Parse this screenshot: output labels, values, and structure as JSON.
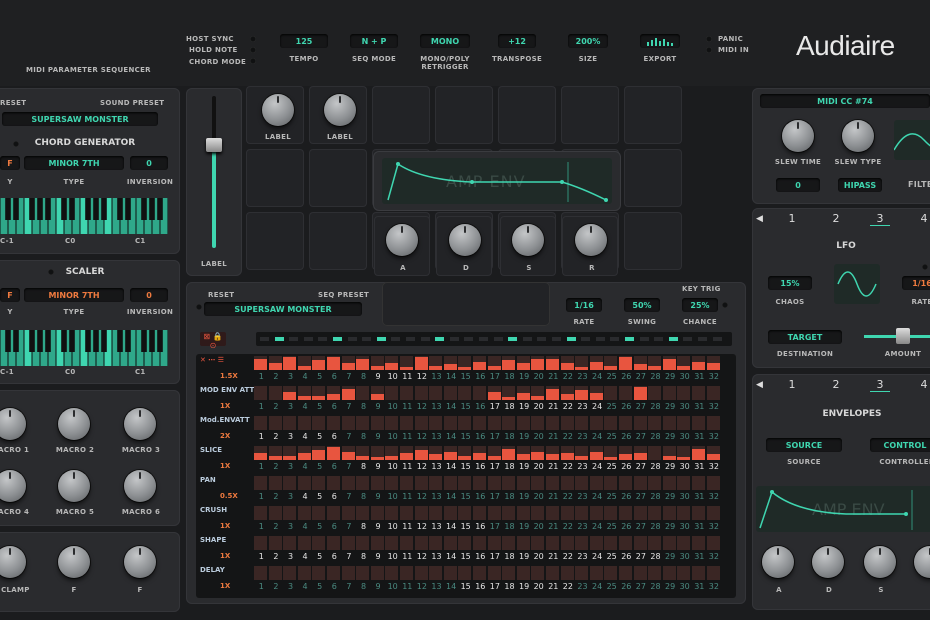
{
  "header": {
    "host_sync": "HOST SYNC",
    "hold_note": "HOLD NOTE",
    "chord_mode": "CHORD MODE",
    "subtitle": "MIDI PARAMETER SEQUENCER",
    "panic": "PANIC",
    "midi_in": "MIDI IN",
    "logo": "Audiaire",
    "params": [
      {
        "value": "125",
        "label": "TEMPO"
      },
      {
        "value": "N + P",
        "label": "SEQ MODE"
      },
      {
        "value": "MONO",
        "label": "MONO/POLY RETRIGGER"
      },
      {
        "value": "+12",
        "label": "TRANSPOSE"
      },
      {
        "value": "200%",
        "label": "SIZE"
      },
      {
        "value": "",
        "label": "EXPORT"
      }
    ]
  },
  "chord": {
    "preset_label": "RESET",
    "sound_preset": "SOUND PRESET",
    "preset_value": "SUPERSAW MONSTER",
    "title": "CHORD GENERATOR",
    "key": "F",
    "type": "MINOR 7TH",
    "inversion": "0",
    "key_label": "Y",
    "type_label": "TYPE",
    "inv_label": "INVERSION",
    "oct": [
      "C-1",
      "C0",
      "C1"
    ]
  },
  "scaler": {
    "title": "SCALER",
    "key": "F",
    "type": "MINOR 7TH",
    "inversion": "0",
    "key_label": "Y",
    "type_label": "TYPE",
    "inv_label": "INVERSION",
    "oct": [
      "C-1",
      "C0",
      "C1"
    ]
  },
  "macros": [
    "MACRO 1",
    "MACRO 2",
    "MACRO 3",
    "MACRO 4",
    "MACRO 5",
    "MACRO 6"
  ],
  "bottom_knobs": [
    "D CLAMP",
    "F",
    "F"
  ],
  "center": {
    "fader_label": "LABEL",
    "knob_labels": [
      "LABEL",
      "LABEL"
    ],
    "env_title": "AMP ENV",
    "adsr": [
      "A",
      "D",
      "S",
      "R"
    ]
  },
  "seq": {
    "reset": "RESET",
    "seq_preset": "SEQ PRESET",
    "preset_value": "SUPERSAW MONSTER",
    "key_trig": "KEY TRIG",
    "rate": "1/16",
    "swing": "50%",
    "chance": "25%",
    "rate_label": "RATE",
    "swing_label": "SWING",
    "chance_label": "CHANCE",
    "rows": [
      {
        "name": "",
        "speed": "1.5X",
        "start": 9,
        "end": 12
      },
      {
        "name": "MOD ENV ATT",
        "speed": "1X",
        "start": 17,
        "end": 24
      },
      {
        "name": "Mod.ENVATT",
        "speed": "2X",
        "start": 1,
        "end": 6
      },
      {
        "name": "SLICE",
        "speed": "1X",
        "start": 8,
        "end": 32
      },
      {
        "name": "PAN",
        "speed": "0.5X",
        "start": 4,
        "end": 6
      },
      {
        "name": "CRUSH",
        "speed": "1X",
        "start": 8,
        "end": 16
      },
      {
        "name": "SHAPE",
        "speed": "1X",
        "start": 1,
        "end": 28
      },
      {
        "name": "DELAY",
        "speed": "1X",
        "start": 15,
        "end": 22
      }
    ]
  },
  "right": {
    "midi_cc": "MIDI CC #74",
    "slew_time": "SLEW TIME",
    "slew_type": "SLEW TYPE",
    "slew_val": "0",
    "slew_type_val": "HIPASS",
    "filter": "FILTE",
    "tabs": [
      "1",
      "2",
      "3",
      "4"
    ],
    "lfo": "LFO",
    "chaos": "15%",
    "chaos_label": "CHAOS",
    "rate": "1/16",
    "rate_label": "RATE",
    "destination": "TARGET",
    "destination_label": "DESTINATION",
    "amount_label": "AMOUNT",
    "env_tabs": [
      "1",
      "2",
      "3",
      "4"
    ],
    "envelopes": "ENVELOPES",
    "source": "SOURCE",
    "source_label": "SOURCE",
    "control": "CONTROL",
    "controller_label": "CONTROLLER",
    "env_title": "AMP ENV",
    "env_knobs": [
      "A",
      "D",
      "S"
    ]
  },
  "colors": {
    "accent": "#3fd6b0",
    "orange": "#ef7a3f",
    "bar": "#e8553f"
  }
}
